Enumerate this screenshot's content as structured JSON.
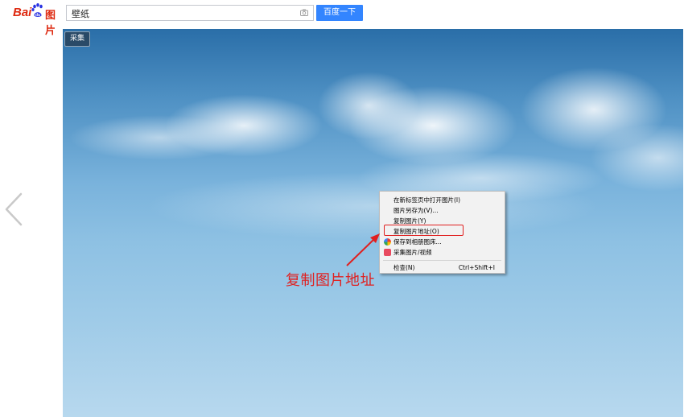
{
  "header": {
    "logo": {
      "text_bai": "Bai",
      "text_du": "du",
      "text_pic": "图片"
    },
    "search": {
      "query": "壁纸"
    },
    "search_button_label": "百度一下"
  },
  "image": {
    "collect_label": "采集"
  },
  "context_menu": {
    "items": [
      {
        "label": "在新标签页中打开图片(I)",
        "icon": ""
      },
      {
        "label": "图片另存为(V)...",
        "icon": ""
      },
      {
        "label": "复制图片(Y)",
        "icon": ""
      },
      {
        "label": "复制图片地址(O)",
        "icon": ""
      },
      {
        "label": "保存到相册图床...",
        "icon": "colorful-circle-icon"
      },
      {
        "label": "采集图片/视频",
        "icon": "red-collect-icon"
      },
      {
        "label": "检查(N)",
        "shortcut": "Ctrl+Shift+I",
        "icon": ""
      }
    ]
  },
  "annotation": {
    "text": "复制图片地址",
    "color": "#e02020"
  },
  "colors": {
    "brand_red": "#de2910",
    "brand_blue": "#3385ff",
    "highlight_red": "#e02020"
  }
}
